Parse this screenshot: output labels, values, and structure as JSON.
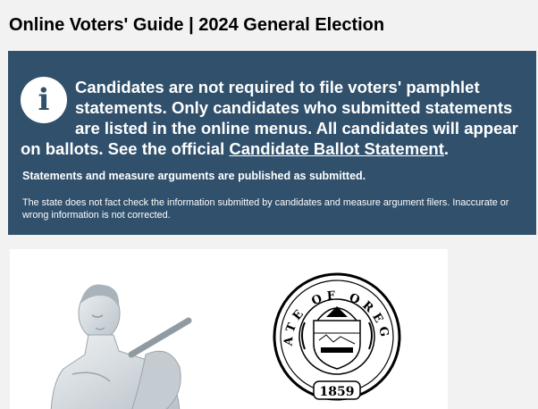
{
  "header": {
    "title": "Online Voters' Guide | 2024 General Election"
  },
  "notice": {
    "icon": "info-icon",
    "main_text": "Candidates are not required to file voters' pamphlet statements. Only candidates who submitted statements are listed in the online menus. All candidates will appear on ballots. See the official ",
    "link_text": "Candidate Ballot Statement",
    "main_end": ".",
    "sub_text": "Statements and measure arguments are published as submitted.",
    "disclaimer": "The state does not fact check the information submitted by candidates and measure argument filers. Inaccurate or wrong information is not corrected.",
    "background_color": "#30506c"
  },
  "images": {
    "left": "oregon-pioneer-statue",
    "right": "state-of-oregon-seal",
    "seal_text_top": "STATE OF OREGON",
    "seal_year": "1859"
  }
}
